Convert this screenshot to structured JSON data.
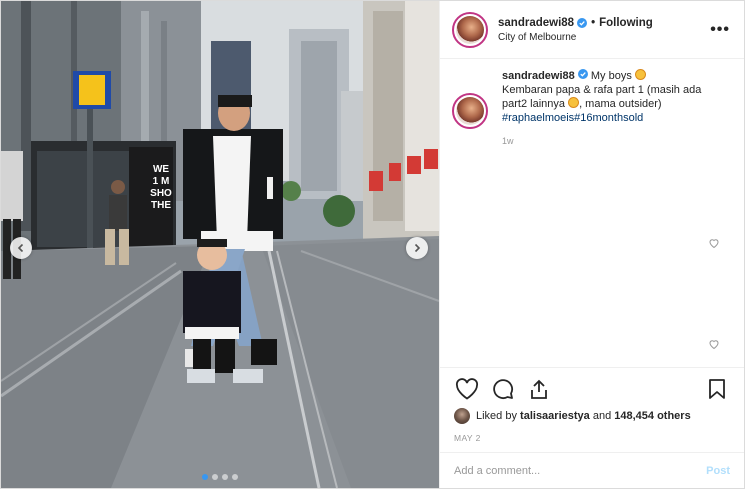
{
  "header": {
    "username": "sandradewi88",
    "separator": "•",
    "follow_status": "Following",
    "location": "City of Melbourne",
    "more_symbol": "•••"
  },
  "caption": {
    "username": "sandradewi88",
    "text_1": "My boys",
    "text_2": "Kembaran papa & rafa part 1 (masih ada part2 lainnya",
    "text_3": ", mama outsider)",
    "hashtags": "#raphaelmoeis#16monthsold",
    "time_ago": "1w"
  },
  "photo": {
    "signage": [
      "WE",
      "1 M",
      "SHO",
      "THE"
    ],
    "carousel_dots": 4,
    "active_dot": 0
  },
  "likes": {
    "prefix": "Liked by",
    "liker": "talisaariestya",
    "connector": "and",
    "count_text": "148,454 others"
  },
  "date": "MAY 2",
  "comment_box": {
    "placeholder": "Add a comment...",
    "post_label": "Post"
  },
  "colors": {
    "verified": "#3897f0",
    "hashtag": "#003569",
    "post_disabled": "#b2dffc",
    "story_ring": "#c13584"
  },
  "icons": [
    "verified-badge-icon",
    "more-options-icon",
    "heart-icon",
    "comment-icon",
    "share-icon",
    "bookmark-icon",
    "chevron-left-icon",
    "chevron-right-icon"
  ]
}
